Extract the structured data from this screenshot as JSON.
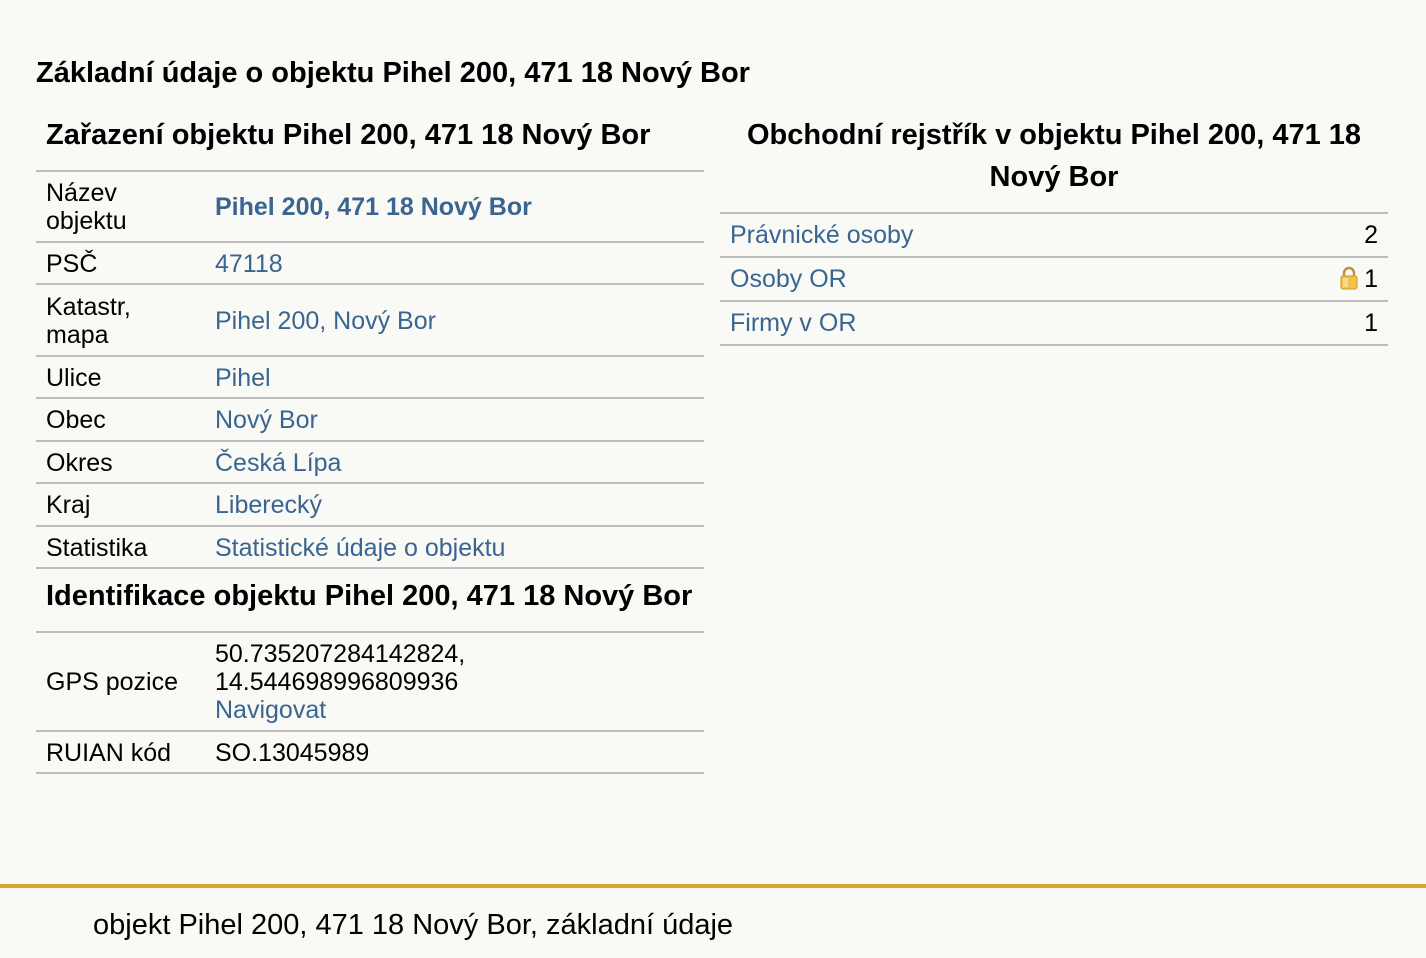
{
  "page_title": "Základní údaje o objektu Pihel 200, 471 18 Nový Bor",
  "classification": {
    "heading": "Zařazení objektu Pihel 200, 471 18 Nový Bor",
    "rows": [
      {
        "label": "Název objektu",
        "value": "Pihel 200, 471 18 Nový Bor"
      },
      {
        "label": "PSČ",
        "value": "47118"
      },
      {
        "label": "Katastr, mapa",
        "value": "Pihel 200, Nový Bor"
      },
      {
        "label": "Ulice",
        "value": "Pihel"
      },
      {
        "label": "Obec",
        "value": "Nový Bor"
      },
      {
        "label": "Okres",
        "value": "Česká Lípa"
      },
      {
        "label": "Kraj",
        "value": "Liberecký"
      },
      {
        "label": "Statistika",
        "value": "Statistické údaje o objektu"
      }
    ]
  },
  "identification": {
    "heading": "Identifikace objektu Pihel 200, 471 18 Nový Bor",
    "gps_label": "GPS pozice",
    "gps_lat": "50.735207284142824,",
    "gps_lon": "14.544698996809936",
    "navigate_label": "Navigovat",
    "ruian_label": "RUIAN kód",
    "ruian_value": "SO.13045989"
  },
  "business_register": {
    "heading": "Obchodní rejstřík v objektu Pihel 200, 471 18 Nový Bor",
    "rows": [
      {
        "label": "Právnické osoby",
        "count": "2",
        "locked": false
      },
      {
        "label": "Osoby OR",
        "count": "1",
        "locked": true,
        "icon": "lock-icon"
      },
      {
        "label": "Firmy v OR",
        "count": "1",
        "locked": false
      }
    ]
  },
  "footer": {
    "text": "objekt Pihel 200, 471 18 Nový Bor, základní údaje"
  },
  "colors": {
    "link": "#3a6591",
    "footer_border": "#d6a72b",
    "background": "#f9f9f6",
    "divider": "#bdbdbd"
  }
}
